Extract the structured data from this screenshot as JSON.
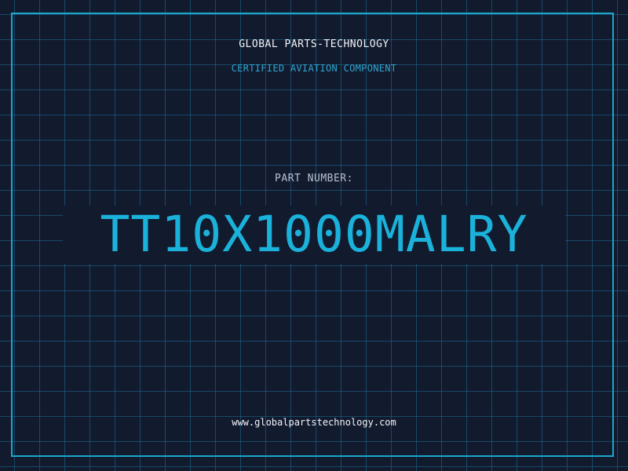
{
  "brand": "GLOBAL PARTS-TECHNOLOGY",
  "tagline": "CERTIFIED AVIATION COMPONENT",
  "part_label": "PART NUMBER:",
  "part_number": "TT10X1000MALRY",
  "website": "www.globalpartstechnology.com",
  "colors": {
    "background": "#121a2e",
    "grid": "#1e6e96",
    "accent": "#1ab2da",
    "frame": "#1aa8cc",
    "text": "#f2f4f7",
    "muted": "#b7c2cf"
  }
}
